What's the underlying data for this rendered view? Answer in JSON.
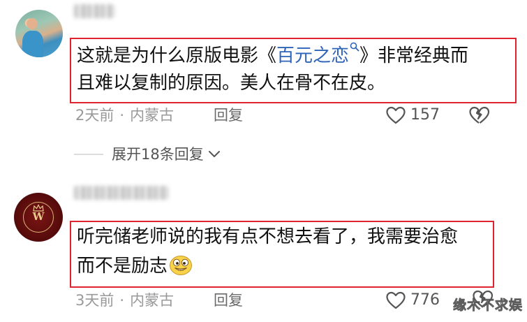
{
  "comments": [
    {
      "username": "▇▇▇",
      "text_line1_before": "这就是为什么原版电影《",
      "text_link": "百元之恋",
      "text_line1_after": "》非常经典而",
      "text_line2": "且难以复制的原因。美人在骨不在皮。",
      "time": "2天前",
      "dot": "·",
      "location": "内蒙古",
      "reply_label": "回复",
      "likes": "157"
    },
    {
      "username": "▇▇▇▇▇▇",
      "avatar_letter": "W",
      "text_line1": "听完储老师说的我有点不想去看了，我需要治愈",
      "text_line2": "而不是励志",
      "time": "3天前",
      "dot": "·",
      "location": "内蒙古",
      "reply_label": "回复",
      "likes": "776"
    }
  ],
  "expand_replies": {
    "label": "展开18条回复"
  },
  "watermark": "缘木不求娱",
  "icons": {
    "like": "heart-outline-icon",
    "dislike": "broken-heart-icon",
    "search": "search-icon",
    "chevron": "chevron-down-icon",
    "emoji": "grinning-emoji-icon",
    "crown": "crown-icon"
  },
  "colors": {
    "highlight_border": "#e0242f",
    "link_blue": "#2e64b8",
    "meta_gray": "#999999"
  }
}
